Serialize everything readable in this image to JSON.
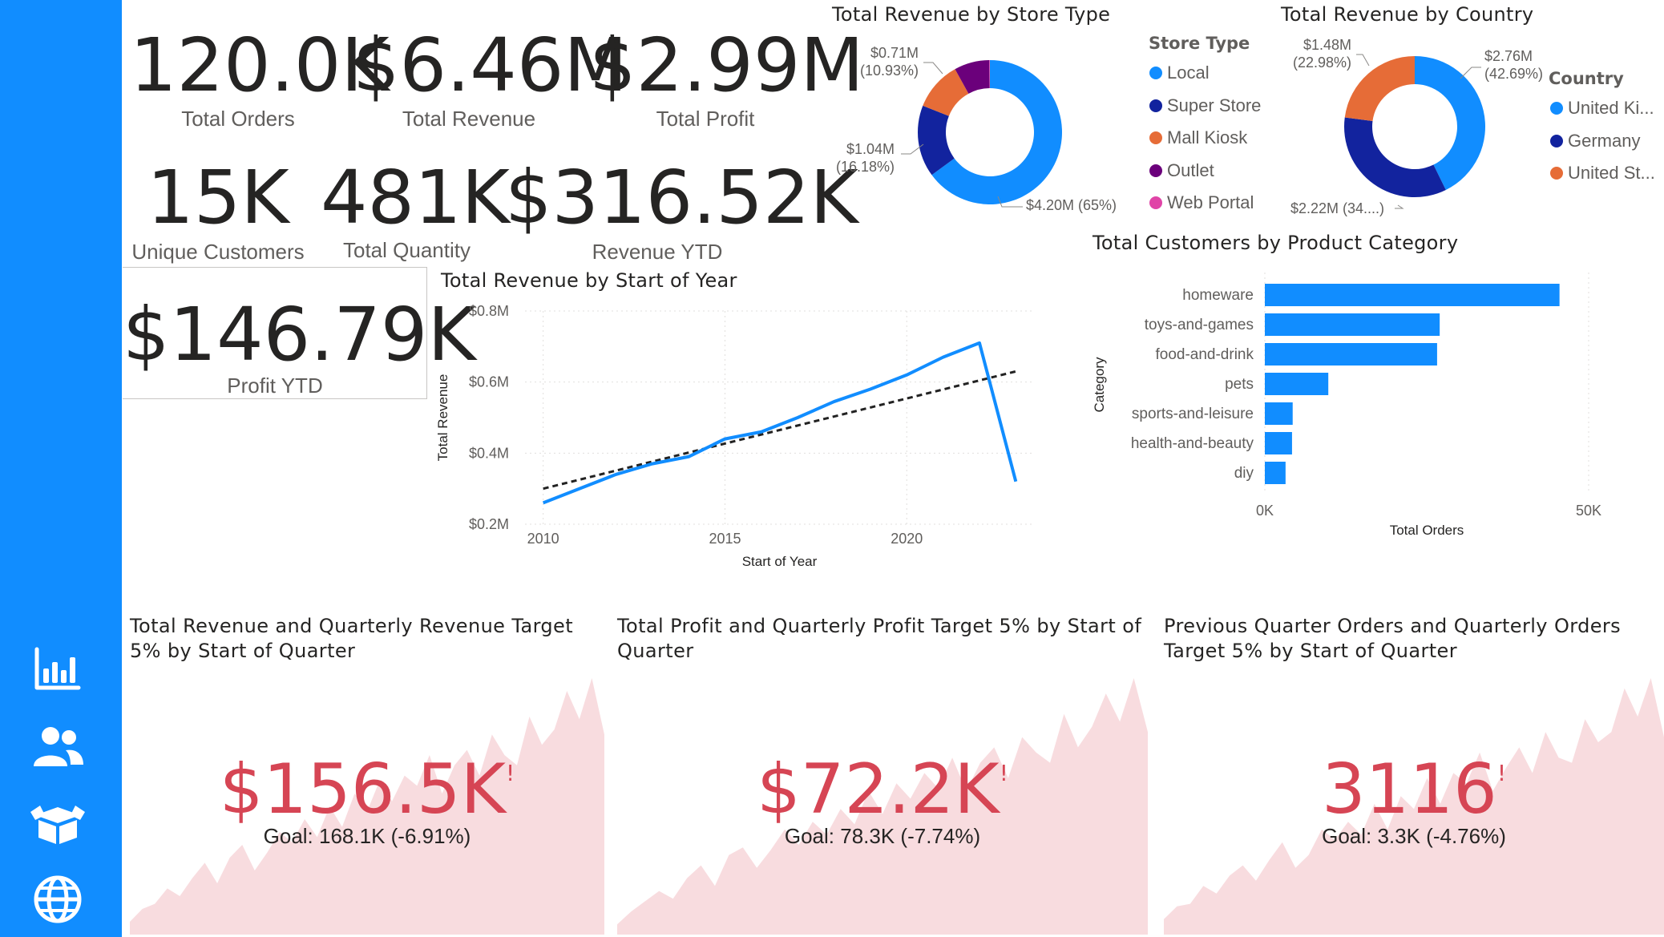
{
  "colors": {
    "sidebar": "#118DFF",
    "line": "#118DFF",
    "bar": "#118DFF",
    "trend": "#222222",
    "kpi_bad": "#D64554",
    "area": "#F8DCDF"
  },
  "nav": {
    "icons": [
      "bar-chart-icon",
      "users-icon",
      "product-box-icon",
      "globe-icon"
    ]
  },
  "kpis": {
    "total_orders": {
      "value": "120.0K",
      "label": "Total Orders"
    },
    "total_revenue": {
      "value": "$6.46M",
      "label": "Total Revenue"
    },
    "total_profit": {
      "value": "$2.99M",
      "label": "Total Profit"
    },
    "unique_customers": {
      "value": "15K",
      "label": "Unique Customers"
    },
    "total_quantity": {
      "value": "481K",
      "label": "Total Quantity"
    },
    "revenue_ytd": {
      "value": "$316.52K",
      "label": "Revenue YTD"
    },
    "profit_ytd": {
      "value": "$146.79K",
      "label": "Profit YTD"
    }
  },
  "chart_data": [
    {
      "id": "store_type",
      "type": "pie",
      "title": "Total Revenue by Store Type",
      "legend_title": "Store Type",
      "legend_position": "right",
      "donut": true,
      "slices": [
        {
          "name": "Local",
          "value": 4.2,
          "label": "$4.20M (65%)",
          "color": "#118DFF"
        },
        {
          "name": "Super Store",
          "value": 1.04,
          "label": "$1.04M\n(16.18%)",
          "color": "#12239E"
        },
        {
          "name": "Mall Kiosk",
          "value": 0.71,
          "label": "$0.71M\n(10.93%)",
          "color": "#E66C37"
        },
        {
          "name": "Outlet",
          "value": 0.51,
          "label": "",
          "color": "#6B007B"
        },
        {
          "name": "Web Portal",
          "value": 0.01,
          "label": "",
          "color": "#E044A7"
        }
      ]
    },
    {
      "id": "country",
      "type": "pie",
      "title": "Total Revenue by Country",
      "legend_title": "Country",
      "legend_position": "right",
      "donut": true,
      "slices": [
        {
          "name": "United Ki...",
          "value": 2.76,
          "label": "$2.76M\n(42.69%)",
          "color": "#118DFF"
        },
        {
          "name": "Germany",
          "value": 2.22,
          "label": "$2.22M (34....)",
          "color": "#12239E"
        },
        {
          "name": "United St...",
          "value": 1.48,
          "label": "$1.48M\n(22.98%)",
          "color": "#E66C37"
        }
      ]
    },
    {
      "id": "revenue_by_year",
      "type": "line",
      "title": "Total Revenue by Start of Year",
      "xlabel": "Start of Year",
      "ylabel": "Total Revenue",
      "x": [
        2010,
        2011,
        2012,
        2013,
        2014,
        2015,
        2016,
        2017,
        2018,
        2019,
        2020,
        2021,
        2022,
        2023
      ],
      "series": [
        {
          "values": [
            0.26,
            0.3,
            0.34,
            0.37,
            0.39,
            0.44,
            0.46,
            0.5,
            0.545,
            0.58,
            0.62,
            0.67,
            0.71,
            0.32
          ]
        }
      ],
      "trendline": {
        "start": [
          2010,
          0.3
        ],
        "end": [
          2023,
          0.63
        ],
        "style": "dashed"
      },
      "xlim": [
        2009.5,
        2023.5
      ],
      "ylim": [
        0.2,
        0.8
      ],
      "xticks": [
        {
          "v": 2010,
          "label": "2010"
        },
        {
          "v": 2015,
          "label": "2015"
        },
        {
          "v": 2020,
          "label": "2020"
        }
      ],
      "yticks": [
        {
          "v": 0.2,
          "label": "$0.2M"
        },
        {
          "v": 0.4,
          "label": "$0.4M"
        },
        {
          "v": 0.6,
          "label": "$0.6M"
        },
        {
          "v": 0.8,
          "label": "$0.8M"
        }
      ],
      "grid": true
    },
    {
      "id": "customers_by_category",
      "type": "bar",
      "orientation": "horizontal",
      "title": "Total Customers by Product Category",
      "xlabel": "Total Orders",
      "ylabel": "Category",
      "categories": [
        "homeware",
        "toys-and-games",
        "food-and-drink",
        "pets",
        "sports-and-leisure",
        "health-and-beauty",
        "diy"
      ],
      "values": [
        45500,
        27000,
        26600,
        9800,
        4300,
        4200,
        3200
      ],
      "xlim": [
        0,
        50000
      ],
      "xticks": [
        {
          "v": 0,
          "label": "0K"
        },
        {
          "v": 50000,
          "label": "50K"
        }
      ],
      "grid": true
    }
  ],
  "gauges": [
    {
      "title": "Total Revenue and Quarterly Revenue Target 5% by Start of Quarter",
      "value": "$156.5K",
      "goal": "Goal: 168.1K (-6.91%)",
      "trend": [
        0.05,
        0.1,
        0.12,
        0.18,
        0.15,
        0.22,
        0.28,
        0.2,
        0.3,
        0.35,
        0.25,
        0.32,
        0.4,
        0.36,
        0.45,
        0.38,
        0.5,
        0.42,
        0.55,
        0.48,
        0.6,
        0.52,
        0.62,
        0.58,
        0.7,
        0.55,
        0.66,
        0.72,
        0.62,
        0.78,
        0.7,
        0.66,
        0.85,
        0.74,
        0.8,
        0.95,
        0.84,
        1.0,
        0.78
      ]
    },
    {
      "title": "Total Profit and Quarterly Profit Target 5% by Start of Quarter",
      "value": "$72.2K",
      "goal": "Goal: 78.3K (-7.74%)",
      "trend": [
        0.04,
        0.09,
        0.13,
        0.17,
        0.14,
        0.22,
        0.27,
        0.19,
        0.31,
        0.34,
        0.26,
        0.33,
        0.41,
        0.35,
        0.44,
        0.39,
        0.49,
        0.43,
        0.56,
        0.47,
        0.59,
        0.53,
        0.63,
        0.57,
        0.69,
        0.56,
        0.67,
        0.73,
        0.61,
        0.77,
        0.71,
        0.67,
        0.86,
        0.73,
        0.81,
        0.94,
        0.83,
        1.0,
        0.79
      ]
    },
    {
      "title": "Previous Quarter Orders and Quarterly Orders Target 5% by Start of Quarter",
      "value": "3116",
      "goal": "Goal: 3.3K (-4.76%)",
      "trend": [
        0.06,
        0.11,
        0.12,
        0.19,
        0.16,
        0.23,
        0.27,
        0.21,
        0.29,
        0.36,
        0.26,
        0.31,
        0.41,
        0.37,
        0.44,
        0.39,
        0.51,
        0.41,
        0.54,
        0.49,
        0.61,
        0.51,
        0.63,
        0.59,
        0.71,
        0.56,
        0.65,
        0.73,
        0.63,
        0.79,
        0.69,
        0.67,
        0.84,
        0.75,
        0.79,
        0.96,
        0.85,
        1.0,
        0.77
      ]
    }
  ]
}
